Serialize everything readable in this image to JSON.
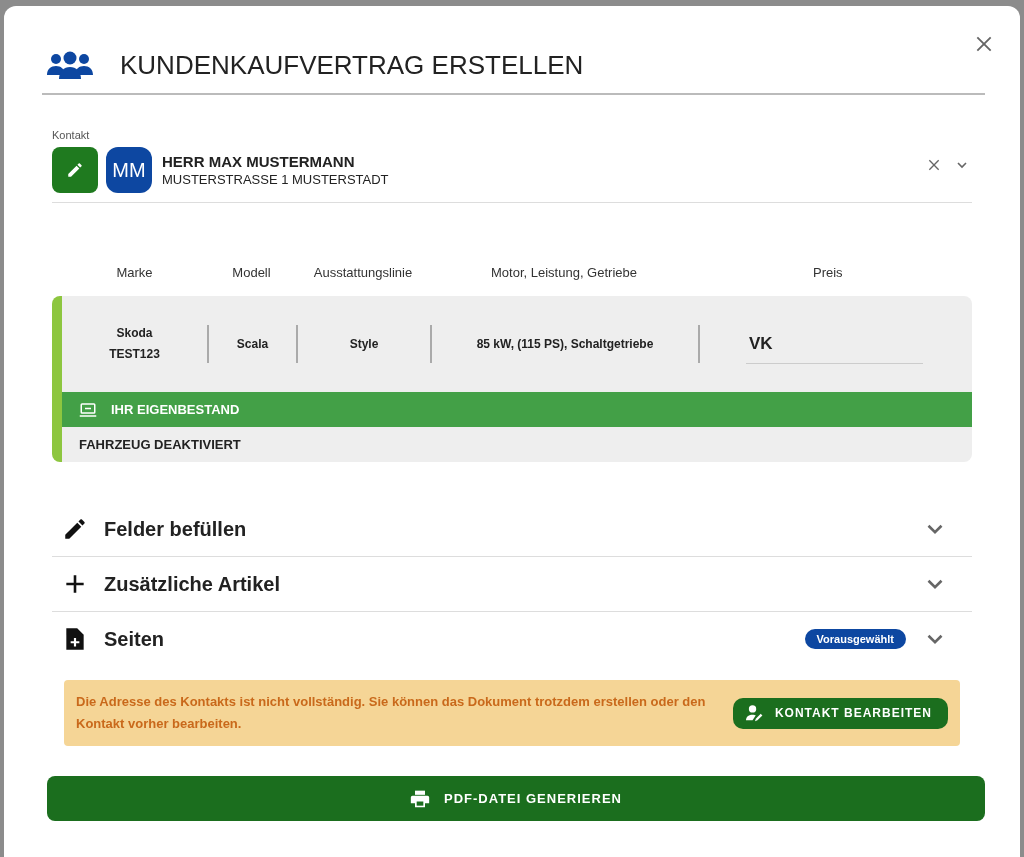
{
  "dialog": {
    "title": "KUNDENKAUFVERTRAG ERSTELLEN"
  },
  "contact": {
    "label": "Kontakt",
    "initials": "MM",
    "name": "HERR MAX MUSTERMANN",
    "address": "MUSTERSTRASSE 1 MUSTERSTADT"
  },
  "vehicle_table": {
    "columns": [
      "Marke",
      "Modell",
      "Ausstattungslinie",
      "Motor, Leistung, Getriebe",
      "Preis"
    ],
    "row": {
      "brand": "Skoda",
      "vehicle_id": "TEST123",
      "model": "Scala",
      "trim": "Style",
      "engine": "85 kW, (115 PS), Schaltgetriebe",
      "price": "VK"
    },
    "stock_banner": "IHR EIGENBESTAND",
    "status": "FAHRZEUG DEAKTIVIERT"
  },
  "sections": [
    {
      "kind": "edit",
      "title": "Felder befüllen",
      "expanded": false
    },
    {
      "kind": "add",
      "title": "Zusätzliche Artikel",
      "expanded": false
    },
    {
      "kind": "page",
      "title": "Seiten",
      "badge": "Vorausgewählt",
      "expanded": false
    }
  ],
  "warning": {
    "text": "Die Adresse des Kontakts ist nicht vollständig. Sie können das Dokument trotzdem erstellen oder den Kontakt vorher bearbeiten.",
    "button": "KONTAKT BEARBEITEN"
  },
  "generate_button": "PDF-DATEI GENERIEREN"
}
